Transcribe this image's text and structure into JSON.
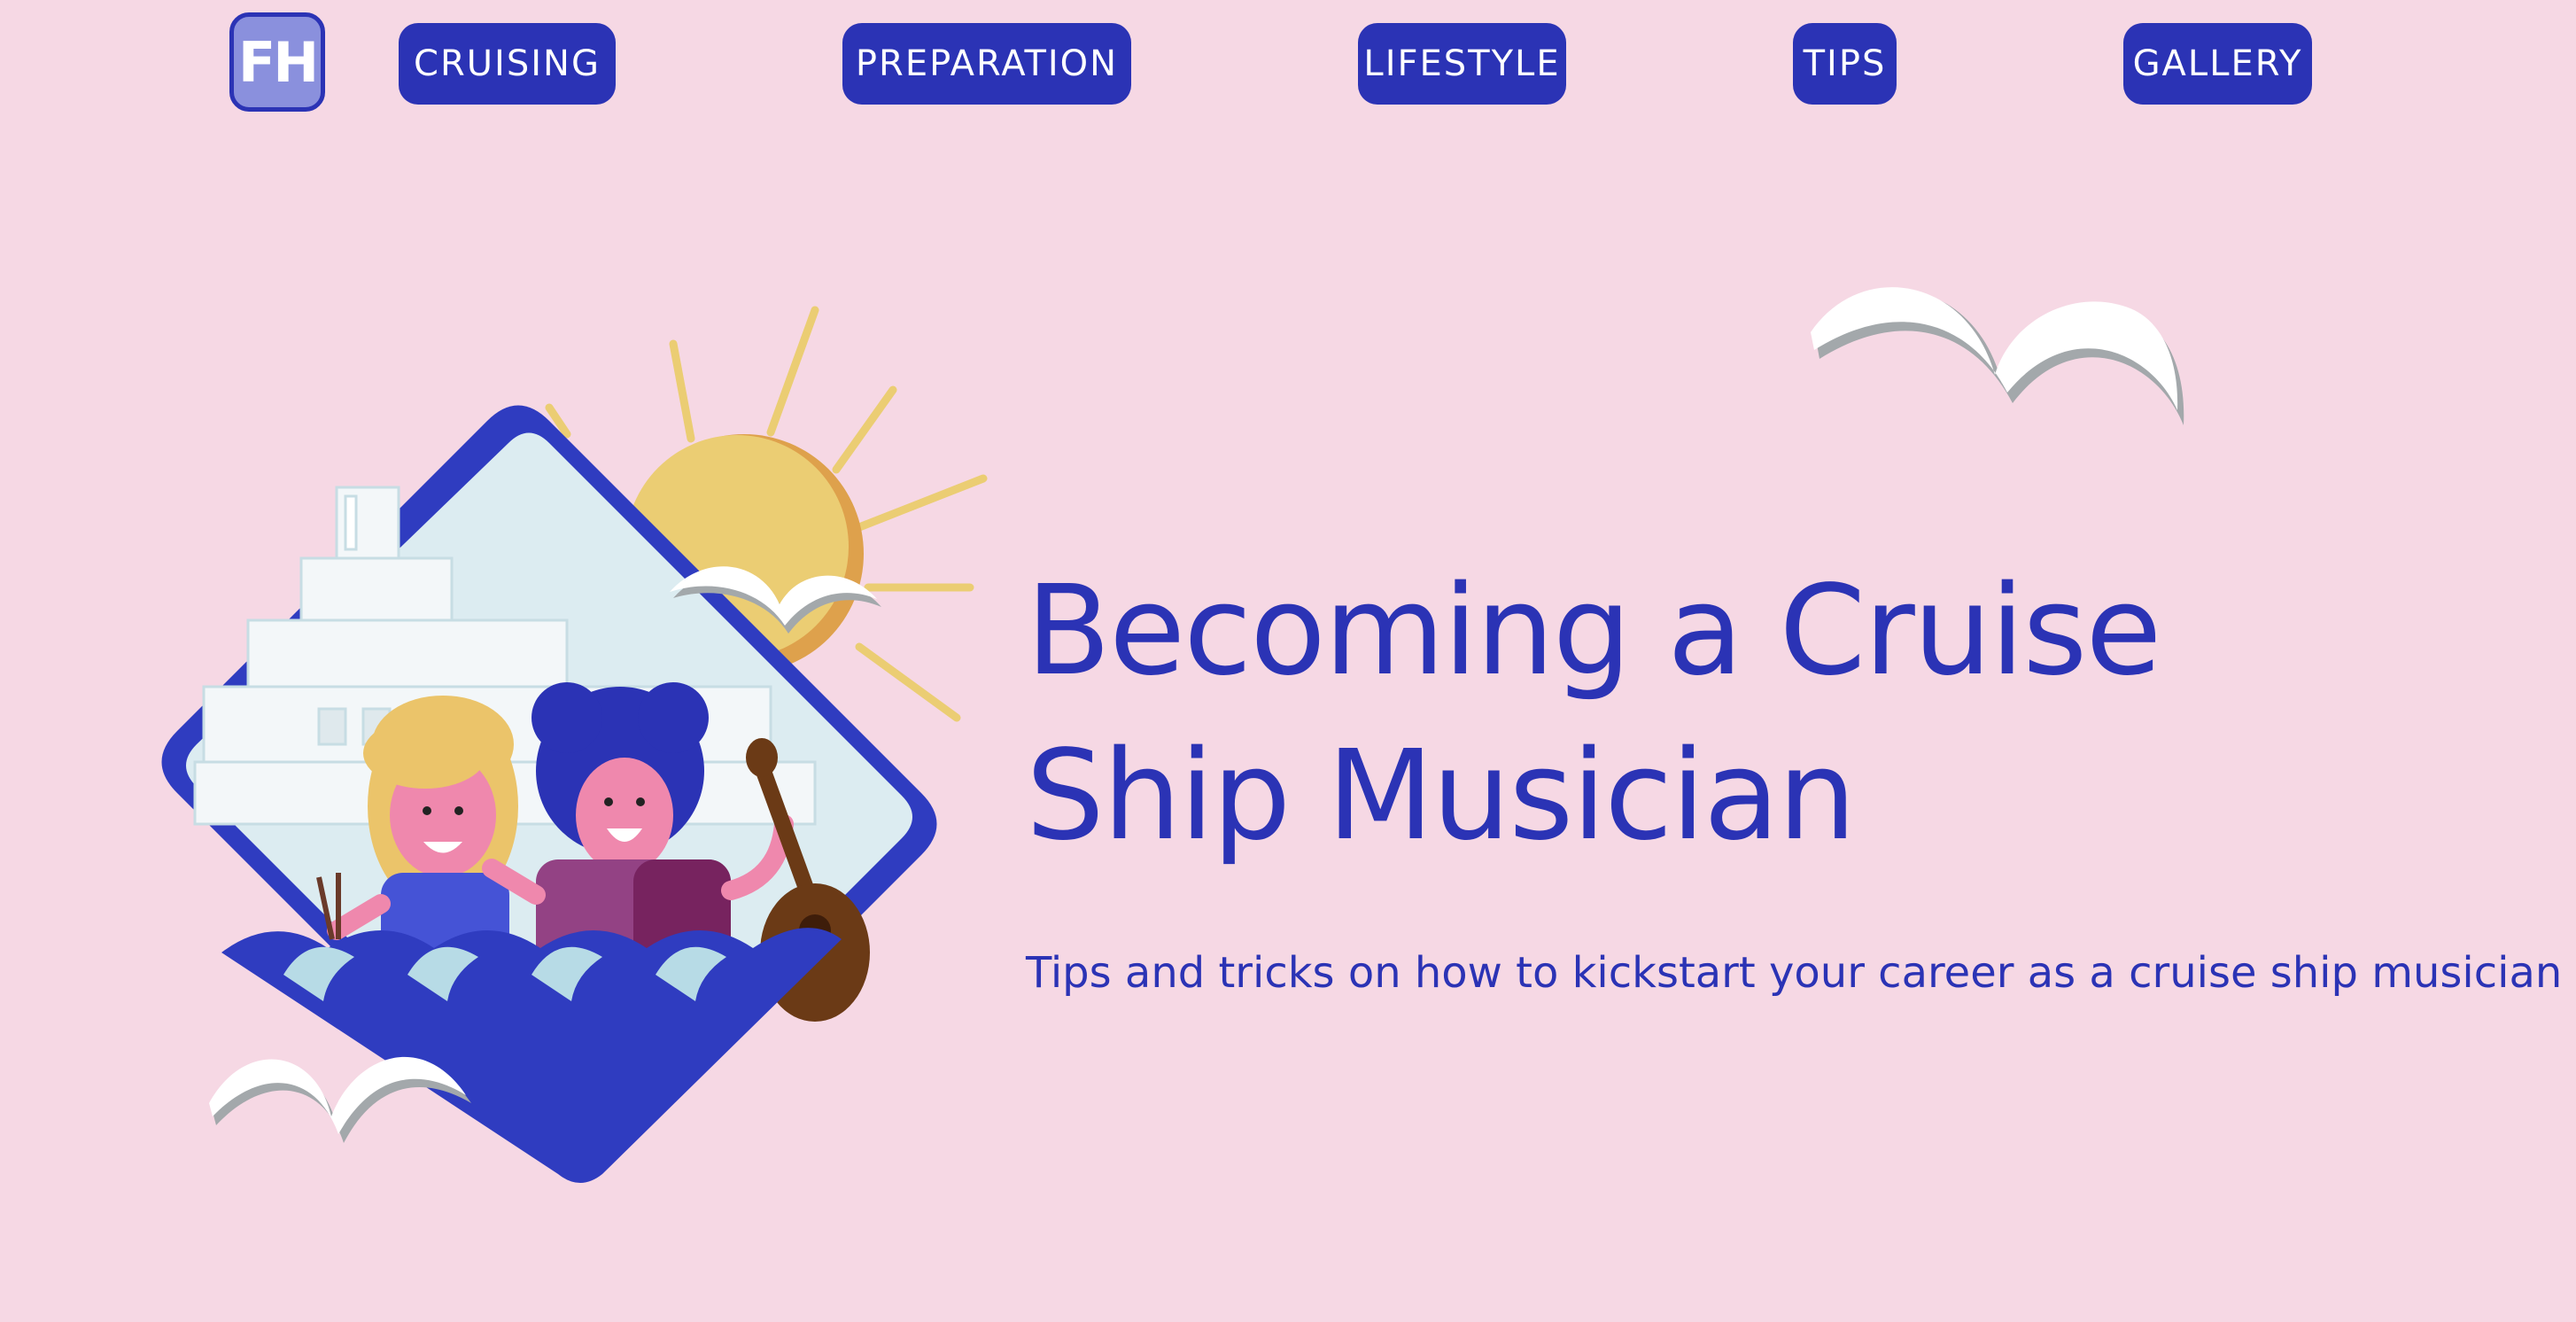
{
  "header": {
    "logo_text": "FH",
    "nav": [
      {
        "label": "CRUISING"
      },
      {
        "label": "PREPARATION"
      },
      {
        "label": "LIFESTYLE"
      },
      {
        "label": "TIPS"
      },
      {
        "label": "GALLERY"
      }
    ]
  },
  "hero": {
    "title": "Becoming a Cruise Ship Musician",
    "subtitle": "Tips and tricks on how to kickstart your career as a cruise ship musician",
    "illustration": "cruise-musicians-illustration"
  },
  "colors": {
    "background": "#f6d8e4",
    "brand_blue": "#2b33b5",
    "logo_fill": "#8a90dd",
    "sun": "#ebcd73",
    "sky": "#dcecf1"
  }
}
